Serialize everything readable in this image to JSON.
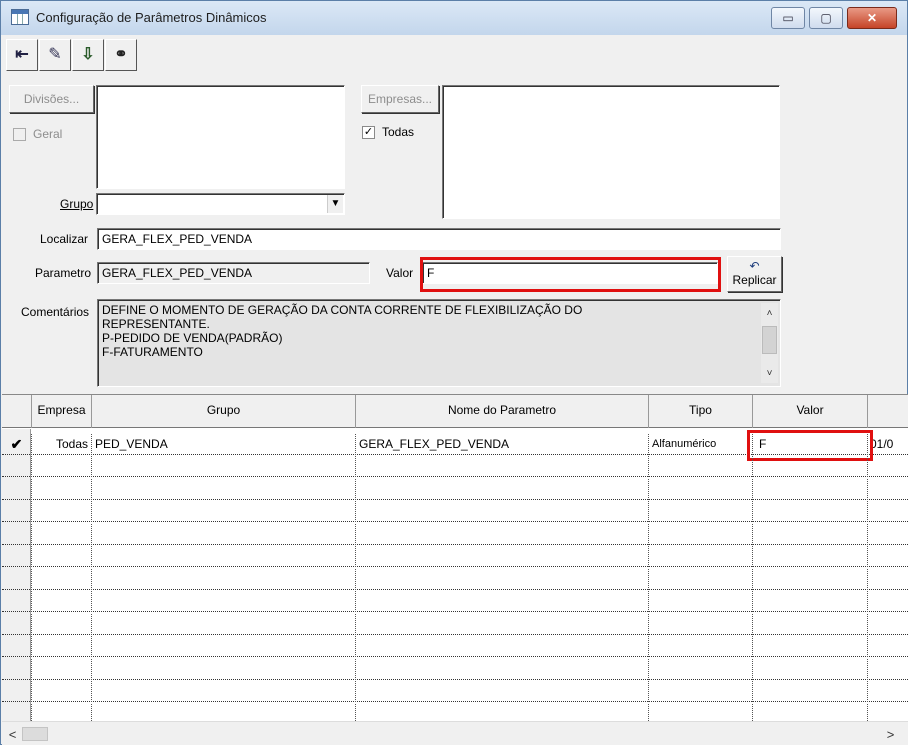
{
  "window": {
    "title": "Configuração de Parâmetros Dinâmicos",
    "controls": {
      "minimize": "▭",
      "maximize": "▢",
      "close": "✕"
    }
  },
  "toolbar": {
    "buttons": [
      {
        "name": "exit-icon",
        "glyph": "⇤"
      },
      {
        "name": "eraser-icon",
        "glyph": "✎"
      },
      {
        "name": "save-icon",
        "glyph": "⇩"
      },
      {
        "name": "binoculars-icon",
        "glyph": "⚭"
      }
    ]
  },
  "filters": {
    "divisoes_button": "Divisões...",
    "geral_label": "Geral",
    "geral_checked": false,
    "empresas_button": "Empresas...",
    "todas_label": "Todas",
    "todas_checked": true,
    "check_mark": "✓",
    "grupo_label": "Grupo",
    "grupo_value": "",
    "combo_arrow": "▼"
  },
  "form": {
    "localizar_label": "Localizar",
    "localizar_value": "GERA_FLEX_PED_VENDA",
    "parametro_label": "Parametro",
    "parametro_value": "GERA_FLEX_PED_VENDA",
    "valor_label": "Valor",
    "valor_value": "F",
    "replicar_icon": "↶",
    "replicar_label": "Replicar",
    "comentarios_label": "Comentários",
    "comentarios_lines": [
      "DEFINE O MOMENTO DE GERAÇÃO DA CONTA CORRENTE DE FLEXIBILIZAÇÃO DO",
      "REPRESENTANTE.",
      "P-PEDIDO DE VENDA(PADRÃO)",
      "F-FATURAMENTO"
    ],
    "scroll_up": "˄",
    "scroll_down": "˅"
  },
  "grid": {
    "columns": [
      "Empresa",
      "Grupo",
      "Nome do Parametro",
      "Tipo",
      "Valor"
    ],
    "rows": [
      {
        "indicator": "✔",
        "empresa": "Todas",
        "grupo": "PED_VENDA",
        "nome": "GERA_FLEX_PED_VENDA",
        "tipo": "Alfanumérico",
        "valor": "F",
        "extra": "01/0"
      }
    ],
    "empty_rows": 12
  },
  "hscroll": {
    "left": "<",
    "right": ">"
  }
}
